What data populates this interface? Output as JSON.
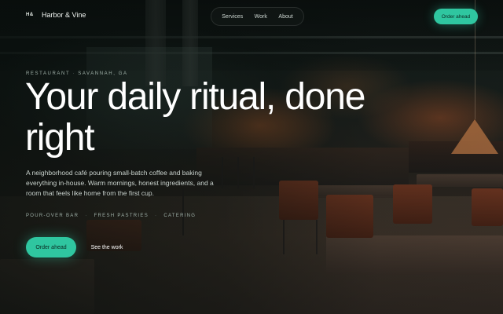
{
  "brand": {
    "mark": "H&",
    "name": "Harbor & Vine"
  },
  "nav": {
    "links": [
      "Services",
      "Work",
      "About"
    ],
    "cta_label": "Order ahead"
  },
  "hero": {
    "eyebrow_left": "Restaurant",
    "eyebrow_right": "Savannah, GA",
    "headline": "Your daily ritual, done right",
    "lede": "A neighborhood café pouring small-batch coffee and baking everything in-house. Warm mornings, honest ingredients, and a room that feels like home from the first cup.",
    "tags": [
      "Pour-over bar",
      "Fresh pastries",
      "Catering"
    ],
    "primary_cta": "Order ahead",
    "secondary_cta": "See the work"
  },
  "colors": {
    "accent": "#2fc6a0",
    "background": "#0d1412"
  }
}
